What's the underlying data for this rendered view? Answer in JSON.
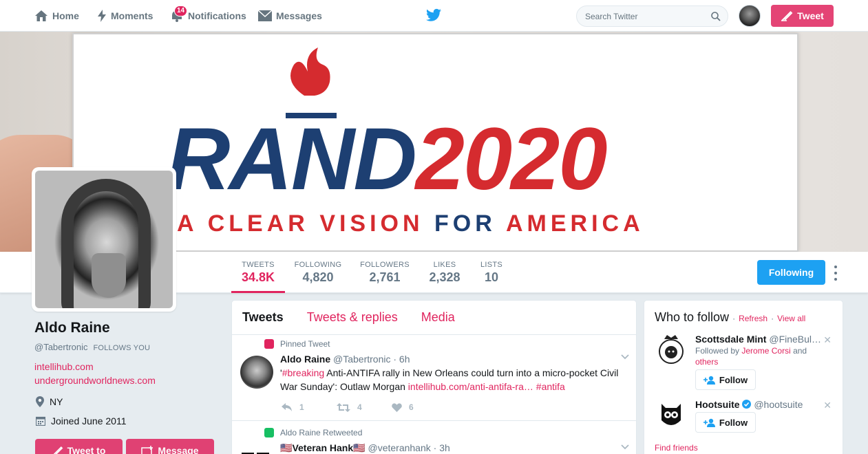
{
  "nav": {
    "home": "Home",
    "moments": "Moments",
    "notifications": "Notifications",
    "notifications_count": "14",
    "messages": "Messages",
    "search_placeholder": "Search Twitter",
    "tweet_button": "Tweet"
  },
  "banner": {
    "brand_left": "RAND",
    "brand_right": "2020",
    "slogan_1": "A CLEAR",
    "slogan_2": "VISION",
    "slogan_3": "FOR",
    "slogan_4": "AMERICA"
  },
  "stats": [
    {
      "label": "TWEETS",
      "value": "34.8K"
    },
    {
      "label": "FOLLOWING",
      "value": "4,820"
    },
    {
      "label": "FOLLOWERS",
      "value": "2,761"
    },
    {
      "label": "LIKES",
      "value": "2,328"
    },
    {
      "label": "LISTS",
      "value": "10"
    }
  ],
  "profile": {
    "following_button": "Following",
    "name": "Aldo Raine",
    "handle": "@Tabertronic",
    "follows_you": "FOLLOWS YOU",
    "link1": "intellihub.com",
    "link2": "undergroundworldnews.com",
    "location": "NY",
    "joined": "Joined June 2011",
    "tweet_to": "Tweet to",
    "message": "Message"
  },
  "timeline": {
    "tabs": [
      "Tweets",
      "Tweets & replies",
      "Media"
    ],
    "tweets": [
      {
        "context": "Pinned Tweet",
        "name": "Aldo Raine",
        "handle": "@Tabertronic",
        "time": "· 6h",
        "body_1": "'",
        "hashtag_1": "#breaking",
        "body_2": " Anti-ANTIFA rally in New Orleans could turn into a micro-pocket Civil War Sunday': Outlaw Morgan ",
        "link": "intellihub.com/anti-antifa-ra…",
        "hashtag_2": "#antifa",
        "replies": "1",
        "retweets": "4",
        "likes": "6"
      },
      {
        "context": "Aldo Raine Retweeted",
        "name_flag": "🇺🇸",
        "name": "Veteran Hank",
        "handle": "@veteranhank",
        "time": "· 3h"
      }
    ]
  },
  "who_to_follow": {
    "title": "Who to follow",
    "refresh": "Refresh",
    "sep": "·",
    "view_all": "View all",
    "follow_label": "Follow",
    "suggestions": [
      {
        "name": "Scottsdale Mint",
        "handle": "@FineBul…",
        "followed_by": "Followed by",
        "followed_name": "Jerome Corsi",
        "and": "and",
        "others": "others"
      },
      {
        "name": "Hootsuite",
        "handle": "@hootsuite"
      }
    ],
    "find_friends": "Find friends"
  },
  "colors": {
    "accent": "#e0245e",
    "blue": "#1da1f2",
    "rand_blue": "#1d3f72",
    "rand_red": "#d52b2f"
  }
}
